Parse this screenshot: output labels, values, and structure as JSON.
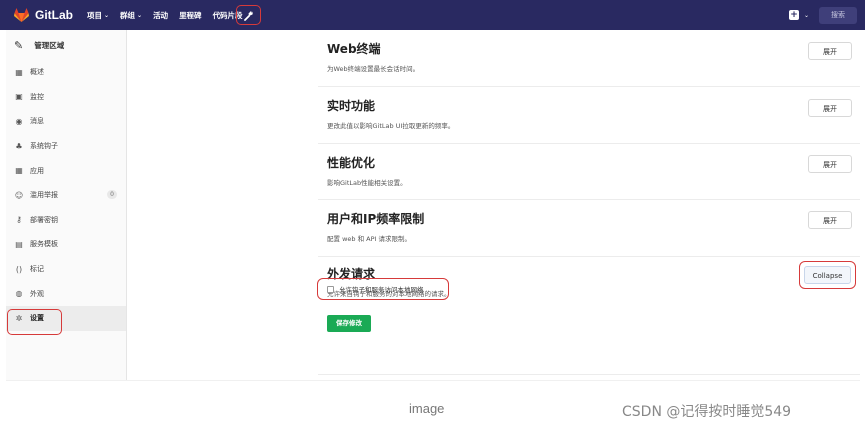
{
  "topbar": {
    "brand": "GitLab",
    "nav": [
      {
        "label": "项目",
        "has_dropdown": true
      },
      {
        "label": "群组",
        "has_dropdown": true
      },
      {
        "label": "活动",
        "has_dropdown": false
      },
      {
        "label": "里程碑",
        "has_dropdown": false
      },
      {
        "label": "代码片段",
        "has_dropdown": false
      }
    ],
    "admin_icon": "wrench-icon",
    "search_placeholder": "搜索",
    "colors": {
      "bar": "#292961"
    }
  },
  "sidebar": {
    "header": "管理区域",
    "items": [
      {
        "label": "概述",
        "icon": "grid-icon"
      },
      {
        "label": "监控",
        "icon": "monitor-icon"
      },
      {
        "label": "消息",
        "icon": "broadcast-icon"
      },
      {
        "label": "系统钩子",
        "icon": "hook-icon"
      },
      {
        "label": "应用",
        "icon": "apps-icon"
      },
      {
        "label": "滥用举报",
        "icon": "report-icon",
        "badge": "0"
      },
      {
        "label": "部署密钥",
        "icon": "key-icon"
      },
      {
        "label": "服务模板",
        "icon": "template-icon"
      },
      {
        "label": "标记",
        "icon": "labels-icon"
      },
      {
        "label": "外观",
        "icon": "palette-icon"
      },
      {
        "label": "设置",
        "icon": "gear-icon",
        "active": true
      }
    ]
  },
  "sections": [
    {
      "title": "Web终端",
      "desc": "为Web终端设置最长会话时间。",
      "button": "展开"
    },
    {
      "title": "实时功能",
      "desc": "更改此值以影响GitLab UI拉取更新的频率。",
      "button": "展开"
    },
    {
      "title": "性能优化",
      "desc": "影响GitLab性能相关设置。",
      "button": "展开"
    },
    {
      "title": "用户和IP频率限制",
      "desc": "配置 web 和 API 请求限制。",
      "button": "展开"
    },
    {
      "title": "外发请求",
      "desc": "允许来自钩子和服务的对本地网络的请求。",
      "button": "Collapse"
    }
  ],
  "outbound": {
    "checkbox_label": "允许钩子和服务访问本地网络",
    "checked": false,
    "save_label": "保存修改"
  },
  "caption": "image",
  "watermark": "CSDN @记得按时睡觉549"
}
